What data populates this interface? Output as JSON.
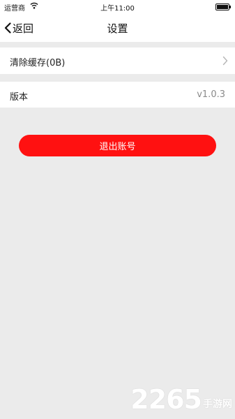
{
  "status_bar": {
    "carrier": "运营商",
    "time": "上午11:00",
    "wifi_icon": "wifi-icon",
    "battery_icon": "battery-icon"
  },
  "nav": {
    "back_label": "返回",
    "back_icon": "chevron-left-icon",
    "title": "设置"
  },
  "settings": {
    "clear_cache_label": "清除缓存(0B)",
    "clear_cache_icon": "chevron-right-icon",
    "version_label": "版本",
    "version_value": "v1.0.3"
  },
  "logout": {
    "label": "退出账号",
    "color": "#ff1111"
  },
  "watermark": {
    "number": "2265",
    "text": "手游网"
  }
}
